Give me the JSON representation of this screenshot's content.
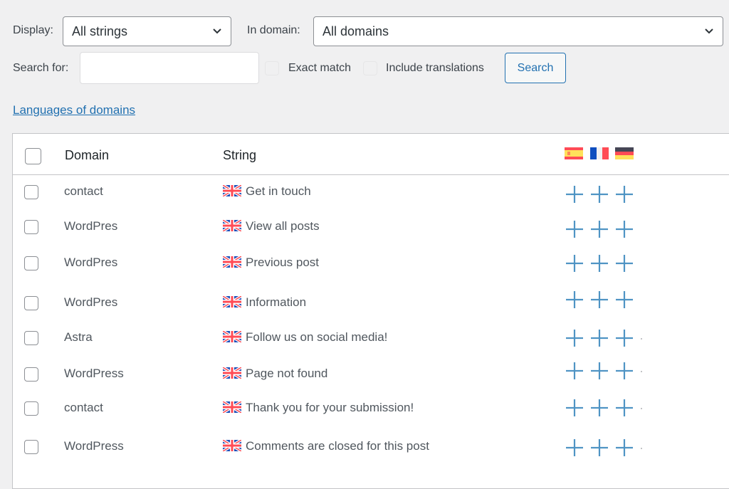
{
  "filters": {
    "display_label": "Display:",
    "display_value": "All strings",
    "domain_label": "In domain:",
    "domain_value": "All domains",
    "search_label": "Search for:",
    "search_value": "",
    "search_placeholder": "",
    "exact_match_label": "Exact match",
    "exact_match_checked": false,
    "include_translations_label": "Include translations",
    "include_translations_checked": false,
    "search_button": "Search"
  },
  "languages_link": "Languages of domains",
  "table": {
    "columns": {
      "domain": "Domain",
      "string": "String",
      "languages": [
        {
          "code": "es",
          "icon": "spain-flag-icon"
        },
        {
          "code": "fr",
          "icon": "france-flag-icon"
        },
        {
          "code": "de",
          "icon": "germany-flag-icon"
        }
      ]
    },
    "source_language_icon": "uk-flag-icon",
    "add_translation_icon": "plus-icon",
    "rows": [
      {
        "domain": "contact",
        "string": "Get in touch"
      },
      {
        "domain": "WordPres",
        "string": "View all posts"
      },
      {
        "domain": "WordPres",
        "string": "Previous post"
      },
      {
        "domain": "WordPres",
        "string": "Information"
      },
      {
        "domain": "Astra",
        "string": "Follow us on social media!"
      },
      {
        "domain": "WordPress",
        "string": "Page not found"
      },
      {
        "domain": "contact",
        "string": "Thank you for your submission!"
      },
      {
        "domain": "WordPress",
        "string": "Comments are closed for this post"
      }
    ]
  },
  "colors": {
    "accent": "#2271b1",
    "plus": "#4f94c4",
    "background": "#f0f0f1"
  }
}
